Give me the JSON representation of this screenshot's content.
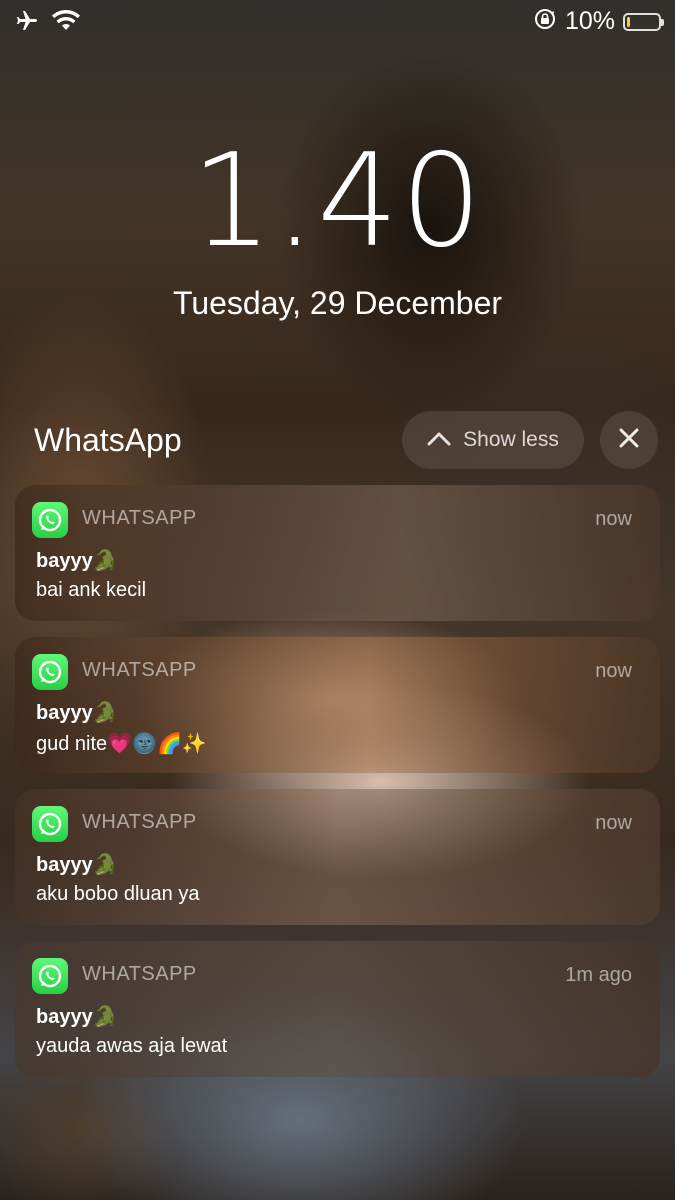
{
  "status_bar": {
    "battery_percent": "10%",
    "battery_level": 0.1,
    "icons": [
      "airplane-icon",
      "wifi-icon",
      "rotation-lock-icon",
      "battery-icon"
    ]
  },
  "lock_screen": {
    "time": "1.40",
    "date": "Tuesday, 29 December"
  },
  "group": {
    "title": "WhatsApp",
    "show_less_label": "Show less"
  },
  "notifications": [
    {
      "app": "WHATSAPP",
      "time": "now",
      "sender": "bayyy🐊",
      "message": "bai ank kecil"
    },
    {
      "app": "WHATSAPP",
      "time": "now",
      "sender": "bayyy🐊",
      "message": "gud nite💗🌚🌈✨"
    },
    {
      "app": "WHATSAPP",
      "time": "now",
      "sender": "bayyy🐊",
      "message": "aku bobo dluan ya"
    },
    {
      "app": "WHATSAPP",
      "time": "1m ago",
      "sender": "bayyy🐊",
      "message": "yauda awas aja lewat"
    }
  ],
  "colors": {
    "whatsapp_green": "#27d045",
    "battery_low": "#f4d03f"
  }
}
